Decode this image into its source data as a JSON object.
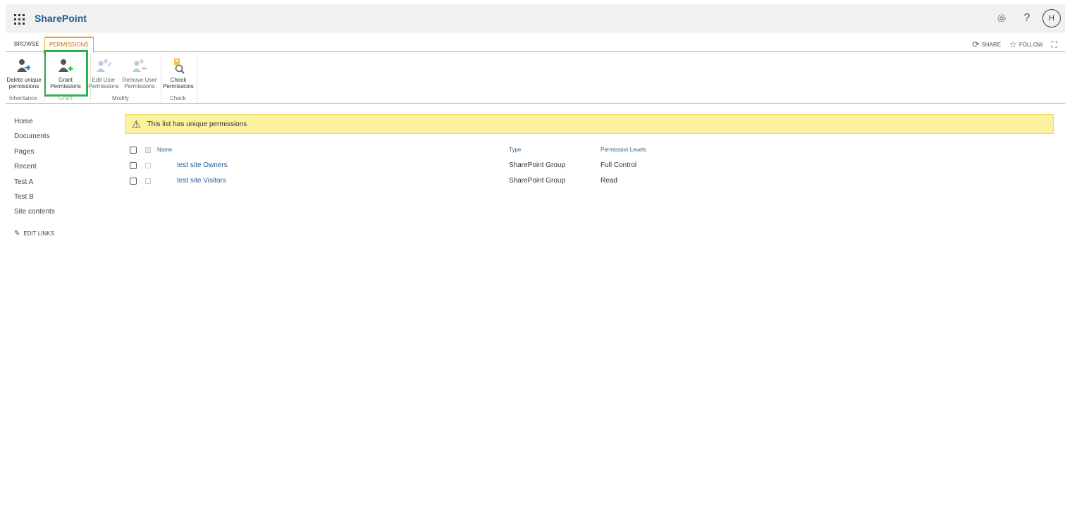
{
  "suitebar": {
    "brand": "SharePoint",
    "avatar_initial": "H"
  },
  "ribbon": {
    "tabs": {
      "browse": "BROWSE",
      "permissions": "PERMISSIONS"
    },
    "actions": {
      "share": "SHARE",
      "follow": "FOLLOW"
    },
    "buttons": {
      "delete_unique": "Delete unique permissions",
      "grant": "Grant Permissions",
      "edit_user": "Edit User Permissions",
      "remove_user": "Remove User Permissions",
      "check": "Check Permissions"
    },
    "groups": {
      "inheritance": "Inheritance",
      "grant": "Grant",
      "modify": "Modify",
      "check": "Check"
    }
  },
  "leftnav": {
    "items": [
      "Home",
      "Documents",
      "Pages",
      "Recent",
      "Test A",
      "Test B",
      "Site contents"
    ],
    "edit_links": "EDIT LINKS"
  },
  "banner": {
    "text": "This list has unique permissions"
  },
  "table": {
    "headers": {
      "name": "Name",
      "type": "Type",
      "levels": "Permission Levels"
    },
    "rows": [
      {
        "name": "test site Owners",
        "type": "SharePoint Group",
        "level": "Full Control"
      },
      {
        "name": "test site Visitors",
        "type": "SharePoint Group",
        "level": "Read"
      }
    ]
  },
  "colors": {
    "accent": "#f4a21d",
    "brand_blue": "#1e5a96",
    "highlight_green": "#2fb34a",
    "banner_yellow": "#fcf0a1"
  },
  "icons": [
    "waffle-icon",
    "settings-gear-icon",
    "help-icon",
    "share-icon",
    "star-icon",
    "focus-icon",
    "warning-icon",
    "pencil-icon"
  ]
}
